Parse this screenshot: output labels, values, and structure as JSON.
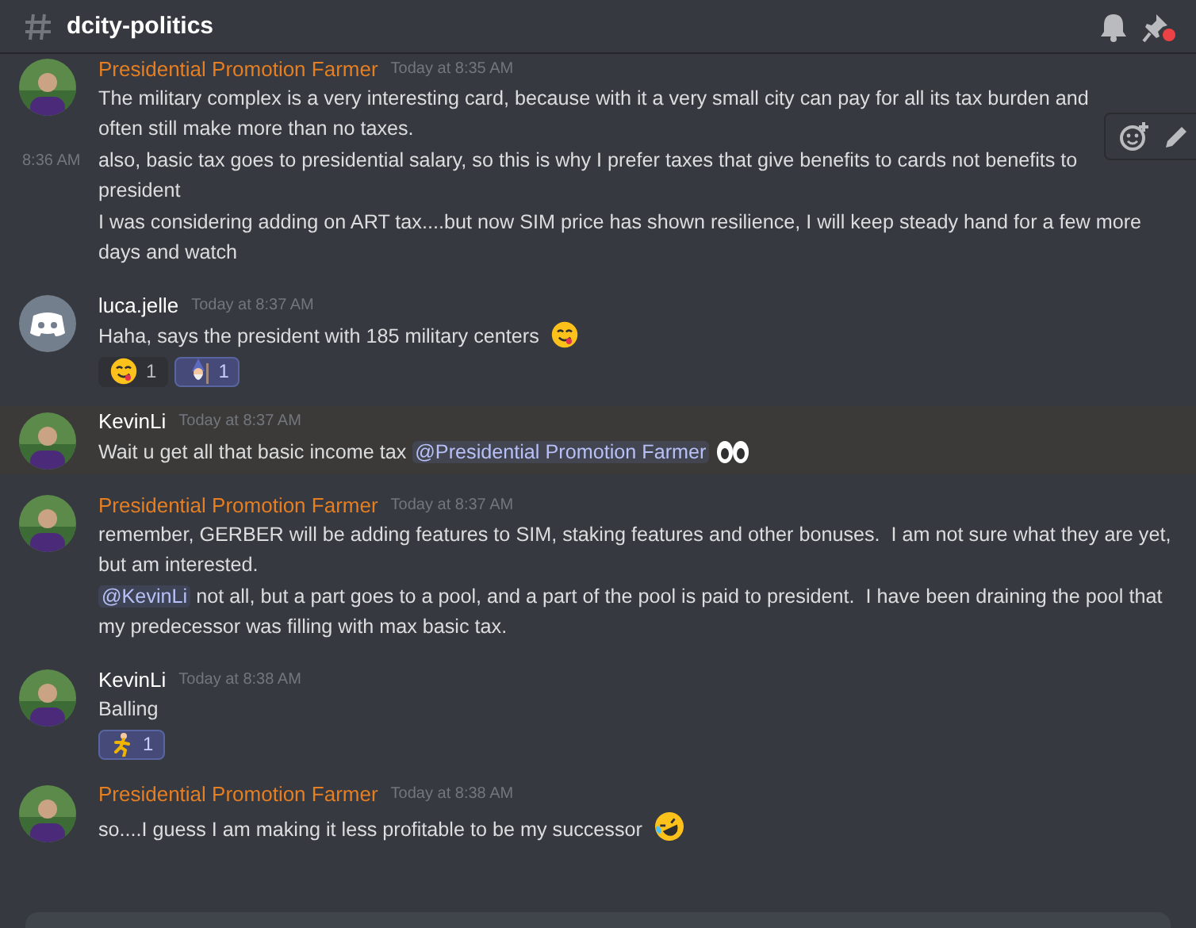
{
  "channel": {
    "name": "dcity-politics"
  },
  "messages": [
    {
      "author": "Presidential Promotion Farmer",
      "color": "#e67e22",
      "time": "Today at 8:35 AM",
      "kind": "photo-avatar",
      "highlighted": false,
      "toolbar": true,
      "lines": [
        {
          "segments": [
            {
              "kind": "text",
              "text": "The military complex is a very interesting card, because with it a very small city can pay for all its tax burden and often still make more than no taxes."
            }
          ]
        },
        {
          "time": "8:36 AM",
          "segments": [
            {
              "kind": "text",
              "text": "also, basic tax goes to presidential salary, so this is why I prefer taxes that give benefits to cards not benefits to president"
            }
          ]
        },
        {
          "segments": [
            {
              "kind": "text",
              "text": "I was considering adding on ART tax....but now SIM price has shown resilience, I will keep steady hand for a few more days and watch"
            }
          ]
        }
      ]
    },
    {
      "author": "luca.jelle",
      "color": "#ffffff",
      "time": "Today at 8:37 AM",
      "kind": "default-avatar",
      "highlighted": false,
      "toolbar": false,
      "lines": [
        {
          "segments": [
            {
              "kind": "text",
              "text": "Haha, says the president with 185 military centers "
            },
            {
              "kind": "yum"
            }
          ]
        }
      ],
      "reactions": [
        {
          "kind": "yum",
          "count": "1",
          "selected": false
        },
        {
          "kind": "wizard",
          "count": "1",
          "selected": true
        }
      ]
    },
    {
      "author": "KevinLi",
      "color": "#ffffff",
      "time": "Today at 8:37 AM",
      "kind": "photo-avatar",
      "highlighted": true,
      "toolbar": false,
      "lines": [
        {
          "segments": [
            {
              "kind": "text",
              "text": "Wait u get all that basic income tax "
            },
            {
              "kind": "mention",
              "text": "@Presidential Promotion Farmer"
            },
            {
              "kind": "eyes"
            }
          ]
        }
      ]
    },
    {
      "author": "Presidential Promotion Farmer",
      "color": "#e67e22",
      "time": "Today at 8:37 AM",
      "kind": "photo-avatar",
      "highlighted": false,
      "toolbar": false,
      "lines": [
        {
          "segments": [
            {
              "kind": "text",
              "text": "remember, GERBER will be adding features to SIM, staking features and other bonuses.  I am not sure what they are yet, but am interested."
            }
          ]
        },
        {
          "segments": [
            {
              "kind": "mention",
              "text": "@KevinLi"
            },
            {
              "kind": "text",
              "text": " not all, but a part goes to a pool, and a part of the pool is paid to president.  I have been draining the pool that my predecessor was filling with max basic tax."
            }
          ]
        }
      ]
    },
    {
      "author": "KevinLi",
      "color": "#ffffff",
      "time": "Today at 8:38 AM",
      "kind": "photo-avatar",
      "highlighted": false,
      "toolbar": false,
      "lines": [
        {
          "segments": [
            {
              "kind": "text",
              "text": "Balling"
            }
          ]
        }
      ],
      "reactions": [
        {
          "kind": "runner",
          "count": "1",
          "selected": true
        }
      ]
    },
    {
      "author": "Presidential Promotion Farmer",
      "color": "#e67e22",
      "time": "Today at 8:38 AM",
      "kind": "photo-avatar",
      "highlighted": false,
      "toolbar": false,
      "lines": [
        {
          "segments": [
            {
              "kind": "text",
              "text": "so....I guess I am making it less profitable to be my successor "
            },
            {
              "kind": "rofl"
            }
          ]
        }
      ]
    }
  ]
}
